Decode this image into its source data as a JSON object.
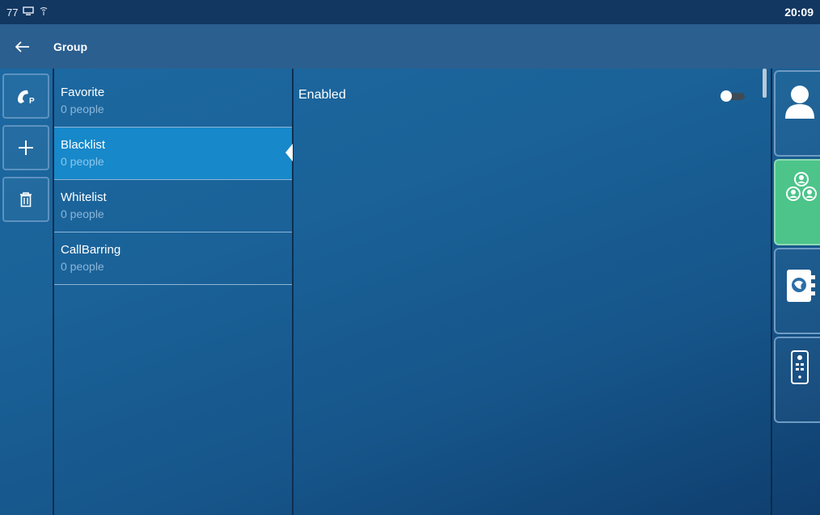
{
  "status_bar": {
    "left_text": "77",
    "time": "20:09",
    "icons": [
      "computer-icon",
      "network-signal-icon"
    ]
  },
  "header": {
    "back_icon": "arrow-left-icon",
    "title": "Group"
  },
  "toolbar": {
    "buttons": [
      {
        "name": "private-call-button",
        "icon": "phone-p-icon"
      },
      {
        "name": "add-button",
        "icon": "plus-icon"
      },
      {
        "name": "delete-button",
        "icon": "trash-icon"
      }
    ]
  },
  "groups": [
    {
      "name": "Favorite",
      "count": "0 people",
      "selected": false
    },
    {
      "name": "Blacklist",
      "count": "0 people",
      "selected": true
    },
    {
      "name": "Whitelist",
      "count": "0 people",
      "selected": false
    },
    {
      "name": "CallBarring",
      "count": "0 people",
      "selected": false
    }
  ],
  "detail": {
    "enabled_label": "Enabled",
    "enabled_value": false
  },
  "right_nav": {
    "items": [
      {
        "name": "contacts",
        "icon": "person-icon",
        "active": false
      },
      {
        "name": "groups",
        "icon": "group-icon",
        "active": true
      },
      {
        "name": "directory",
        "icon": "address-book-icon",
        "active": false
      },
      {
        "name": "device",
        "icon": "device-icon",
        "active": false
      }
    ]
  },
  "colors": {
    "accent_selected": "#1788c9",
    "active_nav": "#4cc48a",
    "header": "#2b5f8f",
    "status_bar": "#123761"
  }
}
